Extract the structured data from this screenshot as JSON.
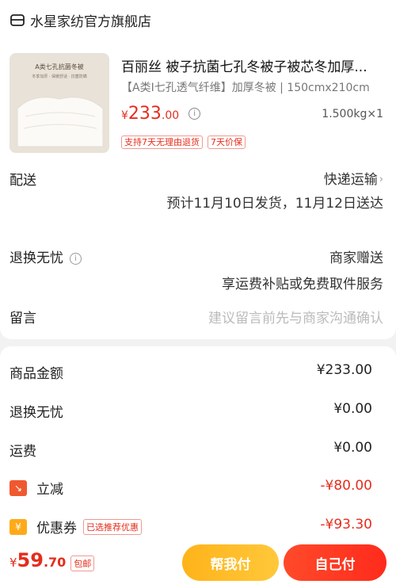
{
  "store": {
    "name": "水星家纺官方旗舰店"
  },
  "product": {
    "image_caption": "A类七孔抗菌冬被",
    "image_sub": "冬季加厚 · 保暖舒适 · 抗菌防螨",
    "title": "百丽丝 被子抗菌七孔冬被子被芯冬加厚...",
    "spec": "【A类I七孔透气纤维】加厚冬被 | 150cmx210cm",
    "price_currency": "¥",
    "price_int": "233",
    "price_dec": ".00",
    "qty": "1.500kg×1",
    "tags": [
      "支持7天无理由退货",
      "7天价保"
    ]
  },
  "delivery": {
    "label": "配送",
    "method": "快递运输",
    "eta": "预计11月10日发货，11月12日送达"
  },
  "returns": {
    "label": "退换无忧",
    "provider": "商家赠送",
    "desc": "享运费补贴或免费取件服务"
  },
  "message": {
    "label": "留言",
    "placeholder": "建议留言前先与商家沟通确认"
  },
  "summary": {
    "goods_label": "商品金额",
    "goods_value": "¥233.00",
    "returns_label": "退换无忧",
    "returns_value": "¥0.00",
    "shipping_label": "运费",
    "shipping_value": "¥0.00",
    "discount_label": "立减",
    "discount_value": "-¥80.00",
    "coupon_label": "优惠券",
    "coupon_badge": "已选推荐优惠",
    "coupon_value": "-¥93.30"
  },
  "bottom": {
    "currency": "¥",
    "int": "59",
    "dec": ".70",
    "pkg": "包邮",
    "help_pay": "帮我付",
    "pay": "自己付"
  },
  "colors": {
    "accent_red": "#e52d1c",
    "accent_orange": "#ffb31a"
  }
}
